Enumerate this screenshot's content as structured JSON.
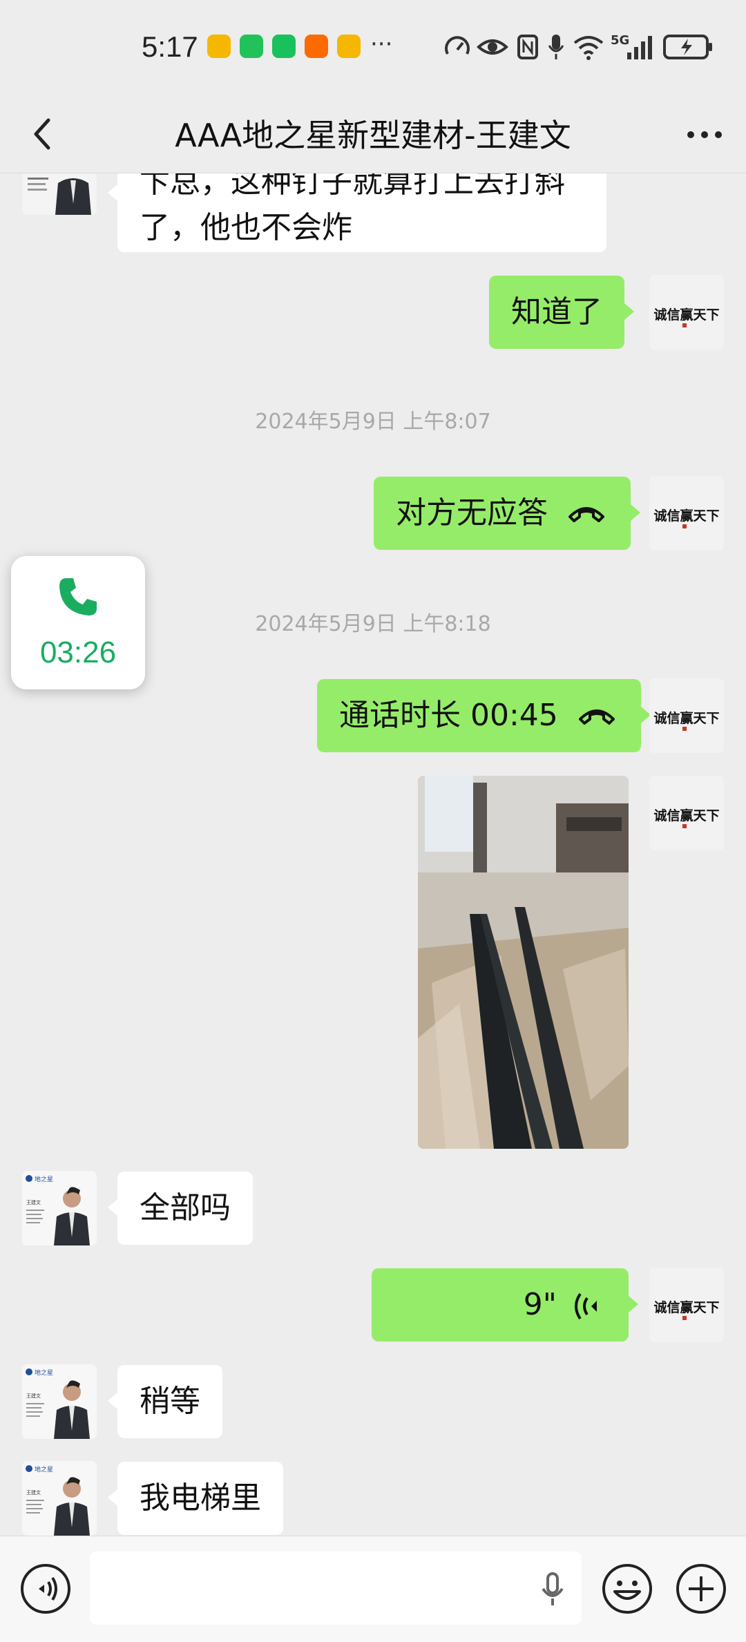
{
  "status_bar": {
    "time": "5:17",
    "more_dots": "···",
    "network": "5G"
  },
  "header": {
    "title": "AAA地之星新型建材-王建文"
  },
  "messages": [
    {
      "sender": "contact",
      "text_line1": "卞总，这种钉子就算打上去打斜",
      "text_line2": "了，他也不会炸"
    },
    {
      "sender": "me",
      "text": "知道了"
    },
    {
      "type": "timestamp",
      "text": "2024年5月9日 上午8:07"
    },
    {
      "sender": "me",
      "type": "call",
      "text": "对方无应答"
    },
    {
      "type": "timestamp",
      "text": "2024年5月9日 上午8:18"
    },
    {
      "sender": "me",
      "type": "call",
      "text": "通话时长 00:45"
    },
    {
      "sender": "me",
      "type": "image"
    },
    {
      "sender": "contact",
      "text": "全部吗"
    },
    {
      "sender": "me",
      "type": "voice",
      "duration": "9\""
    },
    {
      "sender": "contact",
      "text": "稍等"
    },
    {
      "sender": "contact",
      "text": "我电梯里"
    }
  ],
  "call_float": {
    "duration": "03:26",
    "icon": "phone-icon"
  },
  "avatars": {
    "me_text": "诚信赢天下",
    "contact_brand": "地之星",
    "contact_name": "王建文"
  },
  "input_bar": {
    "voice_icon": "voice-mode-icon",
    "mic_icon": "microphone-icon",
    "emoji_icon": "emoji-icon",
    "plus_icon": "plus-icon"
  },
  "colors": {
    "bubble_out": "#95ec69",
    "bubble_in": "#ffffff",
    "background": "#ededed",
    "call_accent": "#1aad60"
  }
}
